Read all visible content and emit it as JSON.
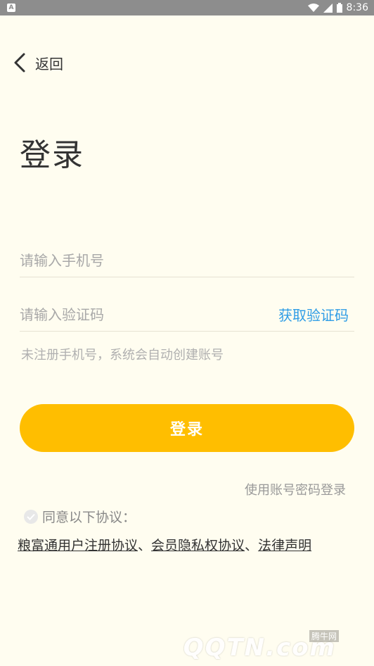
{
  "status_bar": {
    "notification_icon": "A",
    "time": "8:36"
  },
  "nav": {
    "back_label": "返回"
  },
  "title": "登录",
  "form": {
    "phone_placeholder": "请输入手机号",
    "code_placeholder": "请输入验证码",
    "get_code_label": "获取验证码",
    "hint": "未注册手机号，系统会自动创建账号",
    "login_button": "登录",
    "password_login_link": "使用账号密码登录"
  },
  "agreement": {
    "label": "同意以下协议：",
    "links": [
      "粮富通用户注册协议",
      "会员隐私权协议",
      "法律声明"
    ],
    "separator": "、"
  },
  "watermark": {
    "text": "QQTN.com",
    "small_text": "腾牛网"
  },
  "colors": {
    "background": "#fffdf0",
    "accent_button": "#ffbe00",
    "link_blue": "#2f9de6",
    "status_bar": "#8d8d8d"
  }
}
